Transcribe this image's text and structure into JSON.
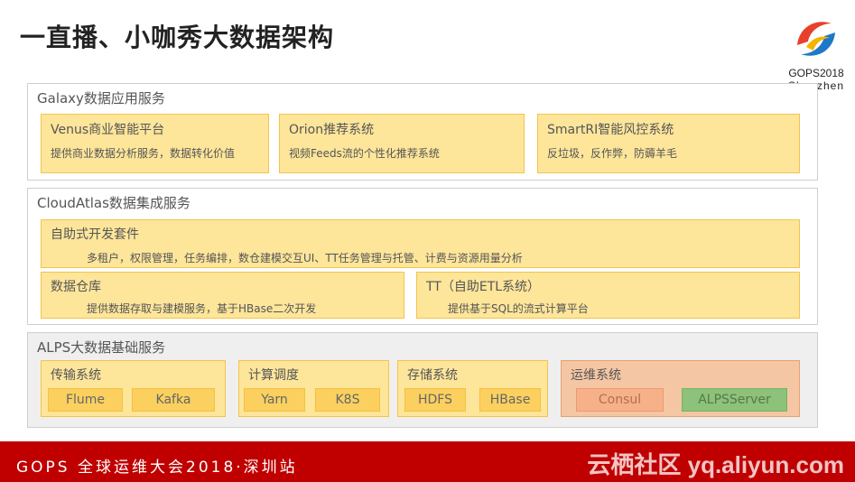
{
  "title": "一直播、小咖秀大数据架构",
  "logo": {
    "line1": "GOPS2018",
    "line2": "Shenzhen"
  },
  "galaxy": {
    "title": "Galaxy数据应用服务",
    "cards": [
      {
        "title": "Venus商业智能平台",
        "desc": "提供商业数据分析服务，数据转化价值"
      },
      {
        "title": "Orion推荐系统",
        "desc": "视频Feeds流的个性化推荐系统"
      },
      {
        "title": "SmartRI智能风控系统",
        "desc": "反垃圾，反作弊，防薅羊毛"
      }
    ]
  },
  "cloudatlas": {
    "title": "CloudAtlas数据集成服务",
    "kit": {
      "title": "自助式开发套件",
      "desc": "多租户，权限管理，任务编排，数仓建模交互UI、TT任务管理与托管、计费与资源用量分析"
    },
    "warehouse": {
      "title": "数据仓库",
      "desc": "提供数据存取与建模服务，基于HBase二次开发"
    },
    "tt": {
      "title": "TT（自助ETL系统）",
      "desc": "提供基于SQL的流式计算平台"
    }
  },
  "alps": {
    "title": "ALPS大数据基础服务",
    "groups": [
      {
        "title": "传输系统",
        "items": [
          "Flume",
          "Kafka"
        ]
      },
      {
        "title": "计算调度",
        "items": [
          "Yarn",
          "K8S"
        ]
      },
      {
        "title": "存储系统",
        "items": [
          "HDFS",
          "HBase"
        ]
      },
      {
        "title": "运维系统",
        "items": [
          "Consul",
          "ALPSServer"
        ]
      }
    ]
  },
  "footer": {
    "left": "GOPS 全球运维大会2018·深圳站",
    "right": "云栖社区 yq.aliyun.com"
  },
  "colors": {
    "card_fill": "#fde59a",
    "card_border": "#f3c44c",
    "chip_fill": "#fbd05f",
    "ops_fill": "#f4c6a4",
    "green_chip": "#8cc27a",
    "footer_bg": "#c00000"
  },
  "icons": {
    "logo": "gops-swirl-logo"
  }
}
